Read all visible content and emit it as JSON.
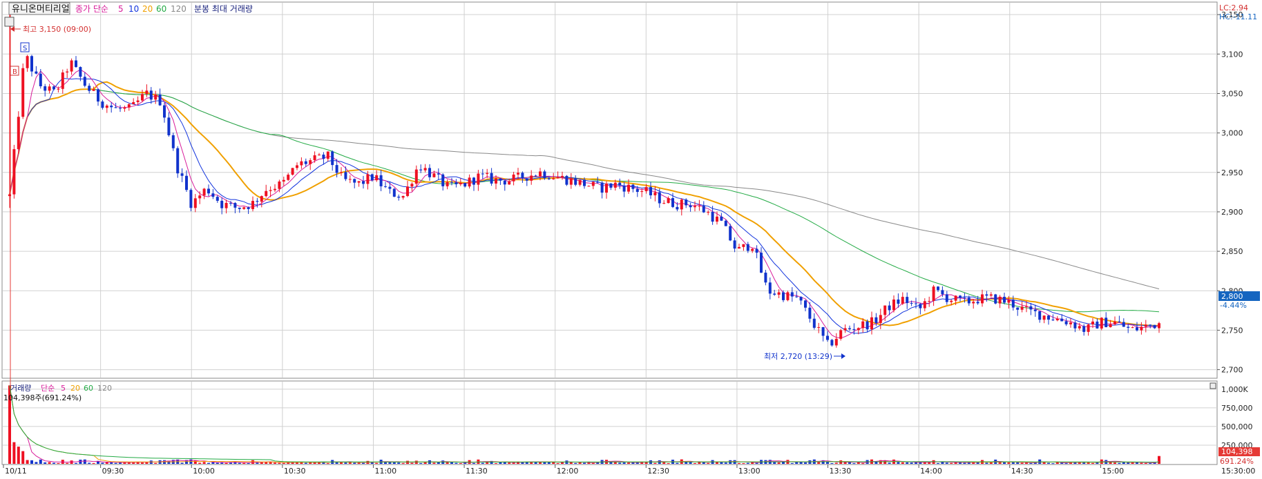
{
  "legend": {
    "stock_name": "유니온머티리얼",
    "price_label": "종가 단순",
    "ma_periods": [
      "5",
      "10",
      "20",
      "60",
      "120"
    ],
    "extra": "분봉 최대 거래량"
  },
  "volume_legend": {
    "label": "거래량",
    "ma_label": "단순",
    "ma_periods": [
      "5",
      "20",
      "60",
      "120"
    ],
    "current": "104,398주(691.24%)"
  },
  "right_panel": {
    "lc": "LC:2.94",
    "hc": "HC:-11.11",
    "price_axis": [
      "3,150",
      "3,100",
      "3,050",
      "3,000",
      "2,950",
      "2,900",
      "2,850",
      "2,800",
      "2,750",
      "2,700"
    ],
    "current_price": "2,800",
    "current_change": "-4.44%",
    "volume_axis": [
      "1,000K",
      "750,000",
      "500,000",
      "250,000"
    ],
    "current_volume": "104,398",
    "current_volume_pct": "691.24%",
    "time_end": "15:30:00"
  },
  "annotations": {
    "high": "최고 3,150 (09:00)",
    "low": "최저 2,720 (13:29)",
    "buy_marker": "B",
    "sell_marker": "S"
  },
  "colors": {
    "up": "#ee1122",
    "down": "#1133cc",
    "ma5": "#d81b9a",
    "ma10": "#1133dd",
    "ma20": "#f0a000",
    "ma60": "#22aa44",
    "ma120": "#888888",
    "grid": "#d0d0d0",
    "axis_bg": "#ffffff",
    "current_tag": "#1565c0",
    "volume_tag": "#e53935"
  },
  "chart_data": {
    "type": "candlestick",
    "date": "10/11",
    "x_ticks": [
      "10/11",
      "09:30",
      "10:00",
      "10:30",
      "11:00",
      "11:30",
      "12:00",
      "12:30",
      "13:00",
      "13:30",
      "14:00",
      "14:30",
      "15:00"
    ],
    "ylim": [
      2690,
      3165
    ],
    "volume_ylim": [
      0,
      1100000
    ],
    "series": [
      {
        "time": "09:00",
        "price": 2920
      },
      {
        "time": "09:05",
        "price": 3100
      },
      {
        "time": "09:10",
        "price": 3060
      },
      {
        "time": "09:15",
        "price": 3050
      },
      {
        "time": "09:20",
        "price": 3090
      },
      {
        "time": "09:25",
        "price": 3060
      },
      {
        "time": "09:30",
        "price": 3040
      },
      {
        "time": "09:35",
        "price": 3030
      },
      {
        "time": "09:40",
        "price": 3030
      },
      {
        "time": "09:45",
        "price": 3050
      },
      {
        "time": "09:50",
        "price": 3040
      },
      {
        "time": "09:55",
        "price": 2960
      },
      {
        "time": "10:00",
        "price": 2910
      },
      {
        "time": "10:05",
        "price": 2930
      },
      {
        "time": "10:10",
        "price": 2910
      },
      {
        "time": "10:15",
        "price": 2905
      },
      {
        "time": "10:20",
        "price": 2910
      },
      {
        "time": "10:25",
        "price": 2930
      },
      {
        "time": "10:30",
        "price": 2935
      },
      {
        "time": "10:35",
        "price": 2960
      },
      {
        "time": "10:40",
        "price": 2965
      },
      {
        "time": "10:45",
        "price": 2970
      },
      {
        "time": "10:50",
        "price": 2940
      },
      {
        "time": "10:55",
        "price": 2935
      },
      {
        "time": "11:00",
        "price": 2945
      },
      {
        "time": "11:05",
        "price": 2925
      },
      {
        "time": "11:10",
        "price": 2920
      },
      {
        "time": "11:15",
        "price": 2960
      },
      {
        "time": "11:20",
        "price": 2945
      },
      {
        "time": "11:25",
        "price": 2930
      },
      {
        "time": "11:30",
        "price": 2935
      },
      {
        "time": "11:35",
        "price": 2945
      },
      {
        "time": "11:40",
        "price": 2940
      },
      {
        "time": "11:45",
        "price": 2940
      },
      {
        "time": "11:50",
        "price": 2945
      },
      {
        "time": "11:55",
        "price": 2950
      },
      {
        "time": "12:00",
        "price": 2945
      },
      {
        "time": "12:05",
        "price": 2940
      },
      {
        "time": "12:10",
        "price": 2935
      },
      {
        "time": "12:15",
        "price": 2930
      },
      {
        "time": "12:20",
        "price": 2935
      },
      {
        "time": "12:25",
        "price": 2930
      },
      {
        "time": "12:30",
        "price": 2925
      },
      {
        "time": "12:35",
        "price": 2915
      },
      {
        "time": "12:40",
        "price": 2910
      },
      {
        "time": "12:45",
        "price": 2910
      },
      {
        "time": "12:50",
        "price": 2900
      },
      {
        "time": "12:55",
        "price": 2885
      },
      {
        "time": "13:00",
        "price": 2850
      },
      {
        "time": "13:05",
        "price": 2860
      },
      {
        "time": "13:10",
        "price": 2800
      },
      {
        "time": "13:15",
        "price": 2795
      },
      {
        "time": "13:20",
        "price": 2790
      },
      {
        "time": "13:25",
        "price": 2760
      },
      {
        "time": "13:30",
        "price": 2730
      },
      {
        "time": "13:35",
        "price": 2750
      },
      {
        "time": "13:40",
        "price": 2755
      },
      {
        "time": "13:45",
        "price": 2760
      },
      {
        "time": "13:50",
        "price": 2780
      },
      {
        "time": "13:55",
        "price": 2790
      },
      {
        "time": "14:00",
        "price": 2775
      },
      {
        "time": "14:05",
        "price": 2800
      },
      {
        "time": "14:10",
        "price": 2790
      },
      {
        "time": "14:15",
        "price": 2785
      },
      {
        "time": "14:20",
        "price": 2790
      },
      {
        "time": "14:25",
        "price": 2790
      },
      {
        "time": "14:30",
        "price": 2785
      },
      {
        "time": "14:35",
        "price": 2775
      },
      {
        "time": "14:40",
        "price": 2770
      },
      {
        "time": "14:45",
        "price": 2765
      },
      {
        "time": "14:50",
        "price": 2760
      },
      {
        "time": "14:55",
        "price": 2750
      },
      {
        "time": "15:00",
        "price": 2760
      },
      {
        "time": "15:05",
        "price": 2760
      },
      {
        "time": "15:10",
        "price": 2750
      },
      {
        "time": "15:15",
        "price": 2755
      },
      {
        "time": "15:20",
        "price": 2760
      }
    ]
  }
}
